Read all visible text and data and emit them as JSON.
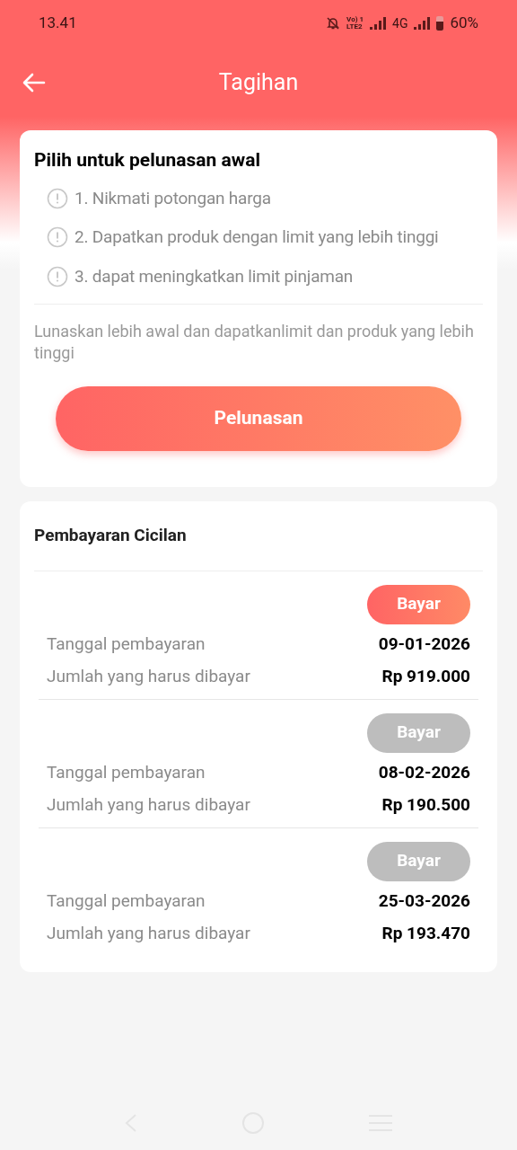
{
  "status_bar": {
    "time": "13.41",
    "volte_top": "Vo) 1",
    "volte_bottom": "LTE2",
    "network": "4G",
    "battery": "60%"
  },
  "header": {
    "title": "Tagihan"
  },
  "early_payoff": {
    "title": "Pilih untuk pelunasan awal",
    "benefits": [
      "1. Nikmati potongan harga",
      "2. Dapatkan produk dengan limit yang lebih tinggi",
      "3. dapat meningkatkan limit pinjaman"
    ],
    "note": "Lunaskan lebih awal dan dapatkanlimit dan produk yang lebih tinggi",
    "button": "Pelunasan"
  },
  "installments": {
    "title": "Pembayaran Cicilan",
    "items": [
      {
        "button": "Bayar",
        "disabled": false,
        "date_label": "Tanggal pembayaran",
        "date": "09-01-2026",
        "amount_label": "Jumlah yang harus dibayar",
        "amount": "Rp 919.000"
      },
      {
        "button": "Bayar",
        "disabled": true,
        "date_label": "Tanggal pembayaran",
        "date": "08-02-2026",
        "amount_label": "Jumlah yang harus dibayar",
        "amount": "Rp 190.500"
      },
      {
        "button": "Bayar",
        "disabled": true,
        "date_label": "Tanggal pembayaran",
        "date": "25-03-2026",
        "amount_label": "Jumlah yang harus dibayar",
        "amount": "Rp 193.470"
      }
    ]
  }
}
